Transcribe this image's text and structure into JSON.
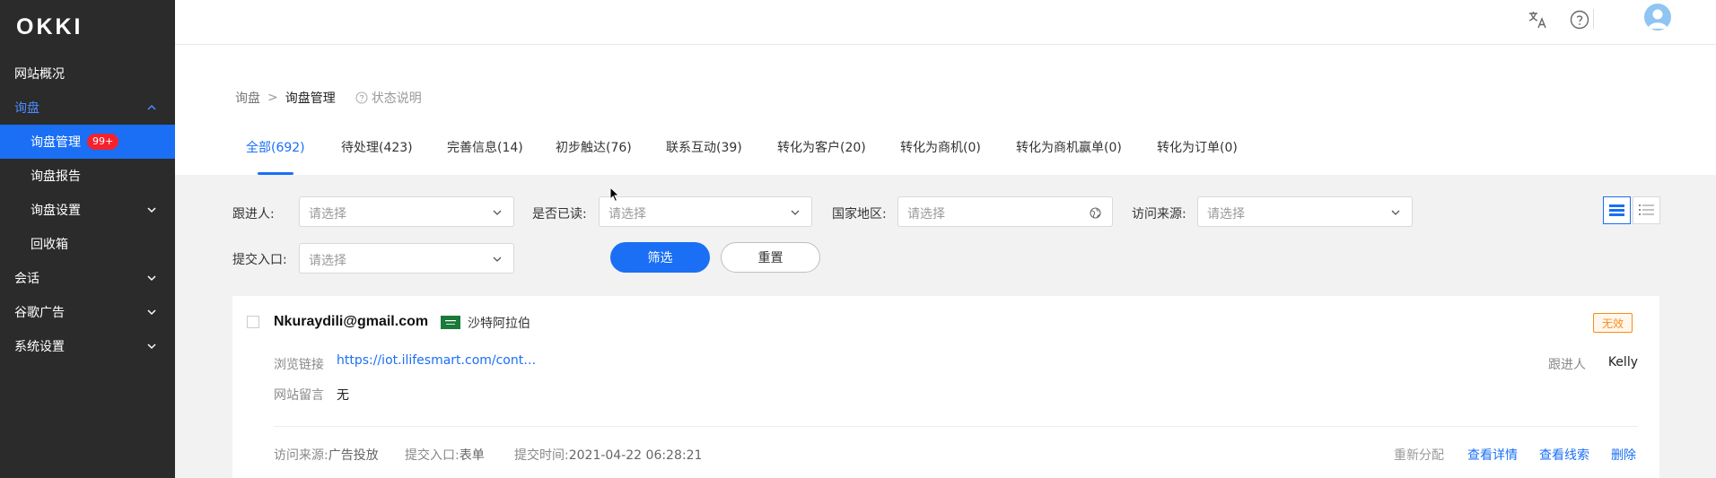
{
  "app": {
    "logo": "OKKI"
  },
  "sidebar": {
    "items": [
      {
        "label": "网站概况"
      },
      {
        "label": "询盘"
      },
      {
        "label": "询盘管理",
        "badge": "99+"
      },
      {
        "label": "询盘报告"
      },
      {
        "label": "询盘设置"
      },
      {
        "label": "回收箱"
      },
      {
        "label": "会话"
      },
      {
        "label": "谷歌广告"
      },
      {
        "label": "系统设置"
      }
    ]
  },
  "header": {
    "icons": [
      "translate-icon",
      "help-icon",
      "avatar"
    ]
  },
  "breadcrumb": {
    "root": "询盘",
    "separator": ">",
    "current": "询盘管理",
    "help_text": "状态说明"
  },
  "tabs": [
    {
      "label": "全部(692)",
      "active": true
    },
    {
      "label": "待处理(423)"
    },
    {
      "label": "完善信息(14)"
    },
    {
      "label": "初步触达(76)"
    },
    {
      "label": "联系互动(39)"
    },
    {
      "label": "转化为客户(20)"
    },
    {
      "label": "转化为商机(0)"
    },
    {
      "label": "转化为商机赢单(0)"
    },
    {
      "label": "转化为订单(0)"
    }
  ],
  "filters": {
    "follower": {
      "label": "跟进人:",
      "placeholder": "请选择"
    },
    "read": {
      "label": "是否已读:",
      "placeholder": "请选择"
    },
    "country": {
      "label": "国家地区:",
      "placeholder": "请选择"
    },
    "source": {
      "label": "访问来源:",
      "placeholder": "请选择"
    },
    "entry": {
      "label": "提交入口:",
      "placeholder": "请选择"
    },
    "filter_button": "筛选",
    "reset_button": "重置"
  },
  "inquiry": {
    "email": "Nkuraydili@gmail.com",
    "country": "沙特阿拉伯",
    "status": "无效",
    "browse_label": "浏览链接",
    "browse_link": "https://iot.ilifesmart.com/cont…",
    "message_label": "网站留言",
    "message_value": "无",
    "follower_label": "跟进人",
    "follower_value": "Kelly",
    "source_label": "访问来源:",
    "source_value": "广告投放",
    "entry_label": "提交入口:",
    "entry_value": "表单",
    "time_label": "提交时间:",
    "time_value": "2021-04-22 06:28:21",
    "actions": {
      "reassign": "重新分配",
      "details": "查看详情",
      "leads": "查看线索",
      "delete": "删除"
    }
  },
  "colors": {
    "primary": "#1a6ff5",
    "sidebar_bg": "#2b2b2b",
    "badge": "#f5222d",
    "invalid_tag": "#fa8c16"
  }
}
